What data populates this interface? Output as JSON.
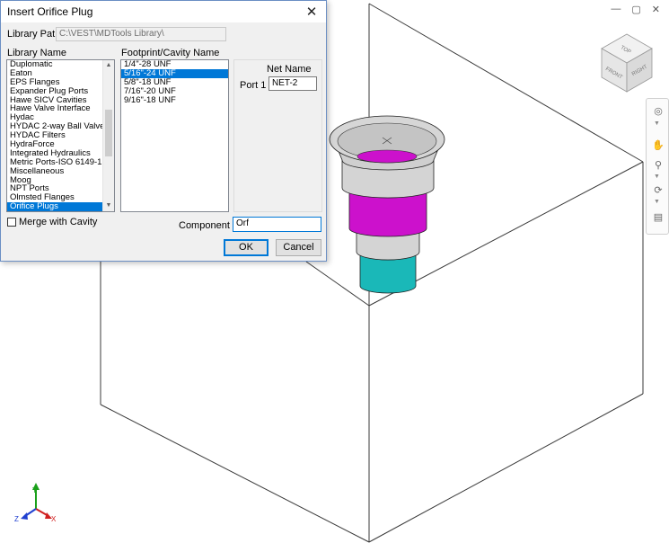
{
  "dialog": {
    "title": "Insert Orifice Plug",
    "library_path_label": "Library Path",
    "library_path_value": "C:\\VEST\\MDTools Library\\",
    "library_name_label": "Library Name",
    "library_items": [
      "Duplomatic",
      "Eaton",
      "EPS Flanges",
      "Expander Plug Ports",
      "Hawe SICV Cavities",
      "Hawe Valve Interface",
      "Hydac",
      "HYDAC 2-way Ball Valves",
      "HYDAC Filters",
      "HydraForce",
      "Integrated Hydraulics",
      "Metric Ports-ISO 6149-1",
      "Miscellaneous",
      "Moog",
      "NPT Ports",
      "Olmsted Flanges",
      "Orifice Plugs"
    ],
    "library_selected": "Orifice Plugs",
    "footprint_label": "Footprint/Cavity Name",
    "footprint_items": [
      "1/4\"-28 UNF",
      "5/16\"-24 UNF",
      "5/8\"-18 UNF",
      "7/16\"-20 UNF",
      "9/16\"-18 UNF"
    ],
    "footprint_selected": "5/16\"-24 UNF",
    "net_name_header": "Net Name",
    "port_label": "Port 1",
    "port_value": "NET-2",
    "merge_label": "Merge with Cavity",
    "merge_checked": false,
    "component_id_label": "Component ID",
    "component_id_value": "Orf",
    "ok_label": "OK",
    "cancel_label": "Cancel"
  },
  "viewcube": {
    "face_top": "TOP",
    "face_front": "FRONT",
    "face_right": "RIGHT"
  },
  "axes": {
    "x": "X",
    "y": "Y",
    "z": "Z"
  },
  "colors": {
    "cavity_band": "#cc11cc",
    "cavity_tip": "#1ab8b8",
    "plug_gray": "#d4d4d4",
    "accent": "#0078d7"
  },
  "icons": [
    "minimize-icon",
    "restore-icon",
    "close-icon",
    "steering-wheel-icon",
    "pan-icon",
    "zoom-icon",
    "orbit-icon",
    "showmotion-icon"
  ]
}
